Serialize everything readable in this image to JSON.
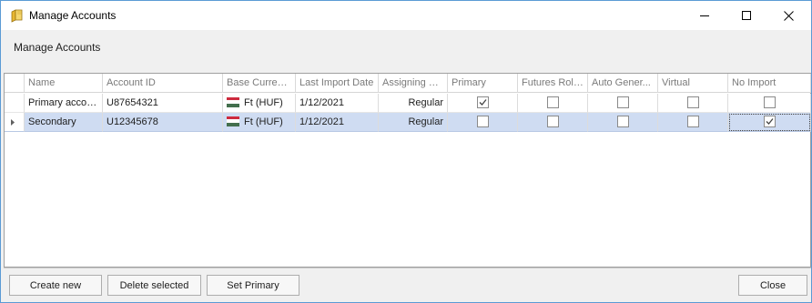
{
  "window": {
    "title": "Manage Accounts",
    "icon": "folder-icon",
    "controls": [
      "minimize-icon",
      "maximize-icon",
      "close-icon"
    ]
  },
  "header": {
    "label": "Manage Accounts"
  },
  "grid": {
    "columns": [
      "Name",
      "Account ID",
      "Base Currency",
      "Last Import Date",
      "Assigning M...",
      "Primary",
      "Futures Roll...",
      "Auto Gener...",
      "Virtual",
      "No Import"
    ],
    "rows": [
      {
        "name": "Primary account",
        "account_id": "U87654321",
        "currency": "Ft (HUF)",
        "last_import": "1/12/2021",
        "assigning": "Regular",
        "primary": true,
        "futures_roll": false,
        "auto_gen": false,
        "virtual": false,
        "no_import": false,
        "selected": false
      },
      {
        "name": "Secondary",
        "account_id": "U12345678",
        "currency": "Ft (HUF)",
        "last_import": "1/12/2021",
        "assigning": "Regular",
        "primary": false,
        "futures_roll": false,
        "auto_gen": false,
        "virtual": false,
        "no_import": true,
        "selected": true
      }
    ],
    "currency_flag": "hungary-flag-icon",
    "selection_color": "#cfdcf2"
  },
  "buttons": {
    "create_new": "Create new",
    "delete_selected": "Delete selected",
    "set_primary": "Set Primary",
    "close": "Close"
  }
}
